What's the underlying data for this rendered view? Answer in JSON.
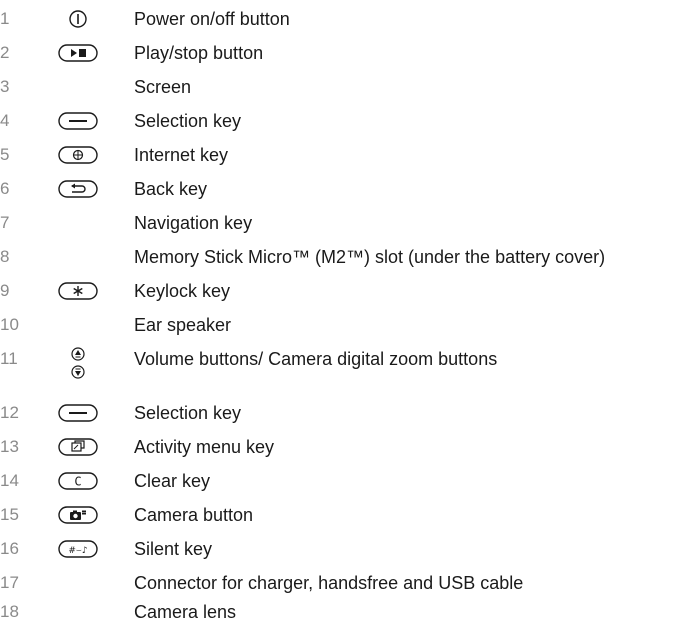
{
  "legend": {
    "items": [
      {
        "number": "1",
        "icon": "power-icon",
        "label": "Power on/off button"
      },
      {
        "number": "2",
        "icon": "play-stop-key-icon",
        "label": "Play/stop button"
      },
      {
        "number": "3",
        "icon": "",
        "label": "Screen"
      },
      {
        "number": "4",
        "icon": "selection-key-icon",
        "label": "Selection key"
      },
      {
        "number": "5",
        "icon": "internet-key-icon",
        "label": "Internet key"
      },
      {
        "number": "6",
        "icon": "back-key-icon",
        "label": "Back key"
      },
      {
        "number": "7",
        "icon": "",
        "label": "Navigation key"
      },
      {
        "number": "8",
        "icon": "",
        "label": "Memory Stick Micro™ (M2™) slot (under the battery cover)"
      },
      {
        "number": "9",
        "icon": "keylock-key-icon",
        "label": "Keylock key"
      },
      {
        "number": "10",
        "icon": "",
        "label": "Ear speaker"
      },
      {
        "number": "11",
        "icon": "volume-buttons-icon",
        "label": "Volume buttons/ Camera digital zoom buttons"
      },
      {
        "number": "12",
        "icon": "selection-key-icon",
        "label": "Selection key"
      },
      {
        "number": "13",
        "icon": "activity-menu-key-icon",
        "label": "Activity menu key"
      },
      {
        "number": "14",
        "icon": "clear-key-icon",
        "label": "Clear key"
      },
      {
        "number": "15",
        "icon": "camera-button-icon",
        "label": "Camera button"
      },
      {
        "number": "16",
        "icon": "silent-key-icon",
        "label": "Silent key"
      },
      {
        "number": "17",
        "icon": "",
        "label": "Connector for charger, handsfree and USB cable"
      },
      {
        "number": "18",
        "icon": "",
        "label": "Camera lens"
      }
    ],
    "icon_glyphs": {
      "keylock": "*",
      "clear": "C",
      "silent": "#⌣♪"
    },
    "colors": {
      "number": "#8a8a8a",
      "text": "#1a1a1a",
      "icon_stroke": "#1a1a1a"
    }
  }
}
